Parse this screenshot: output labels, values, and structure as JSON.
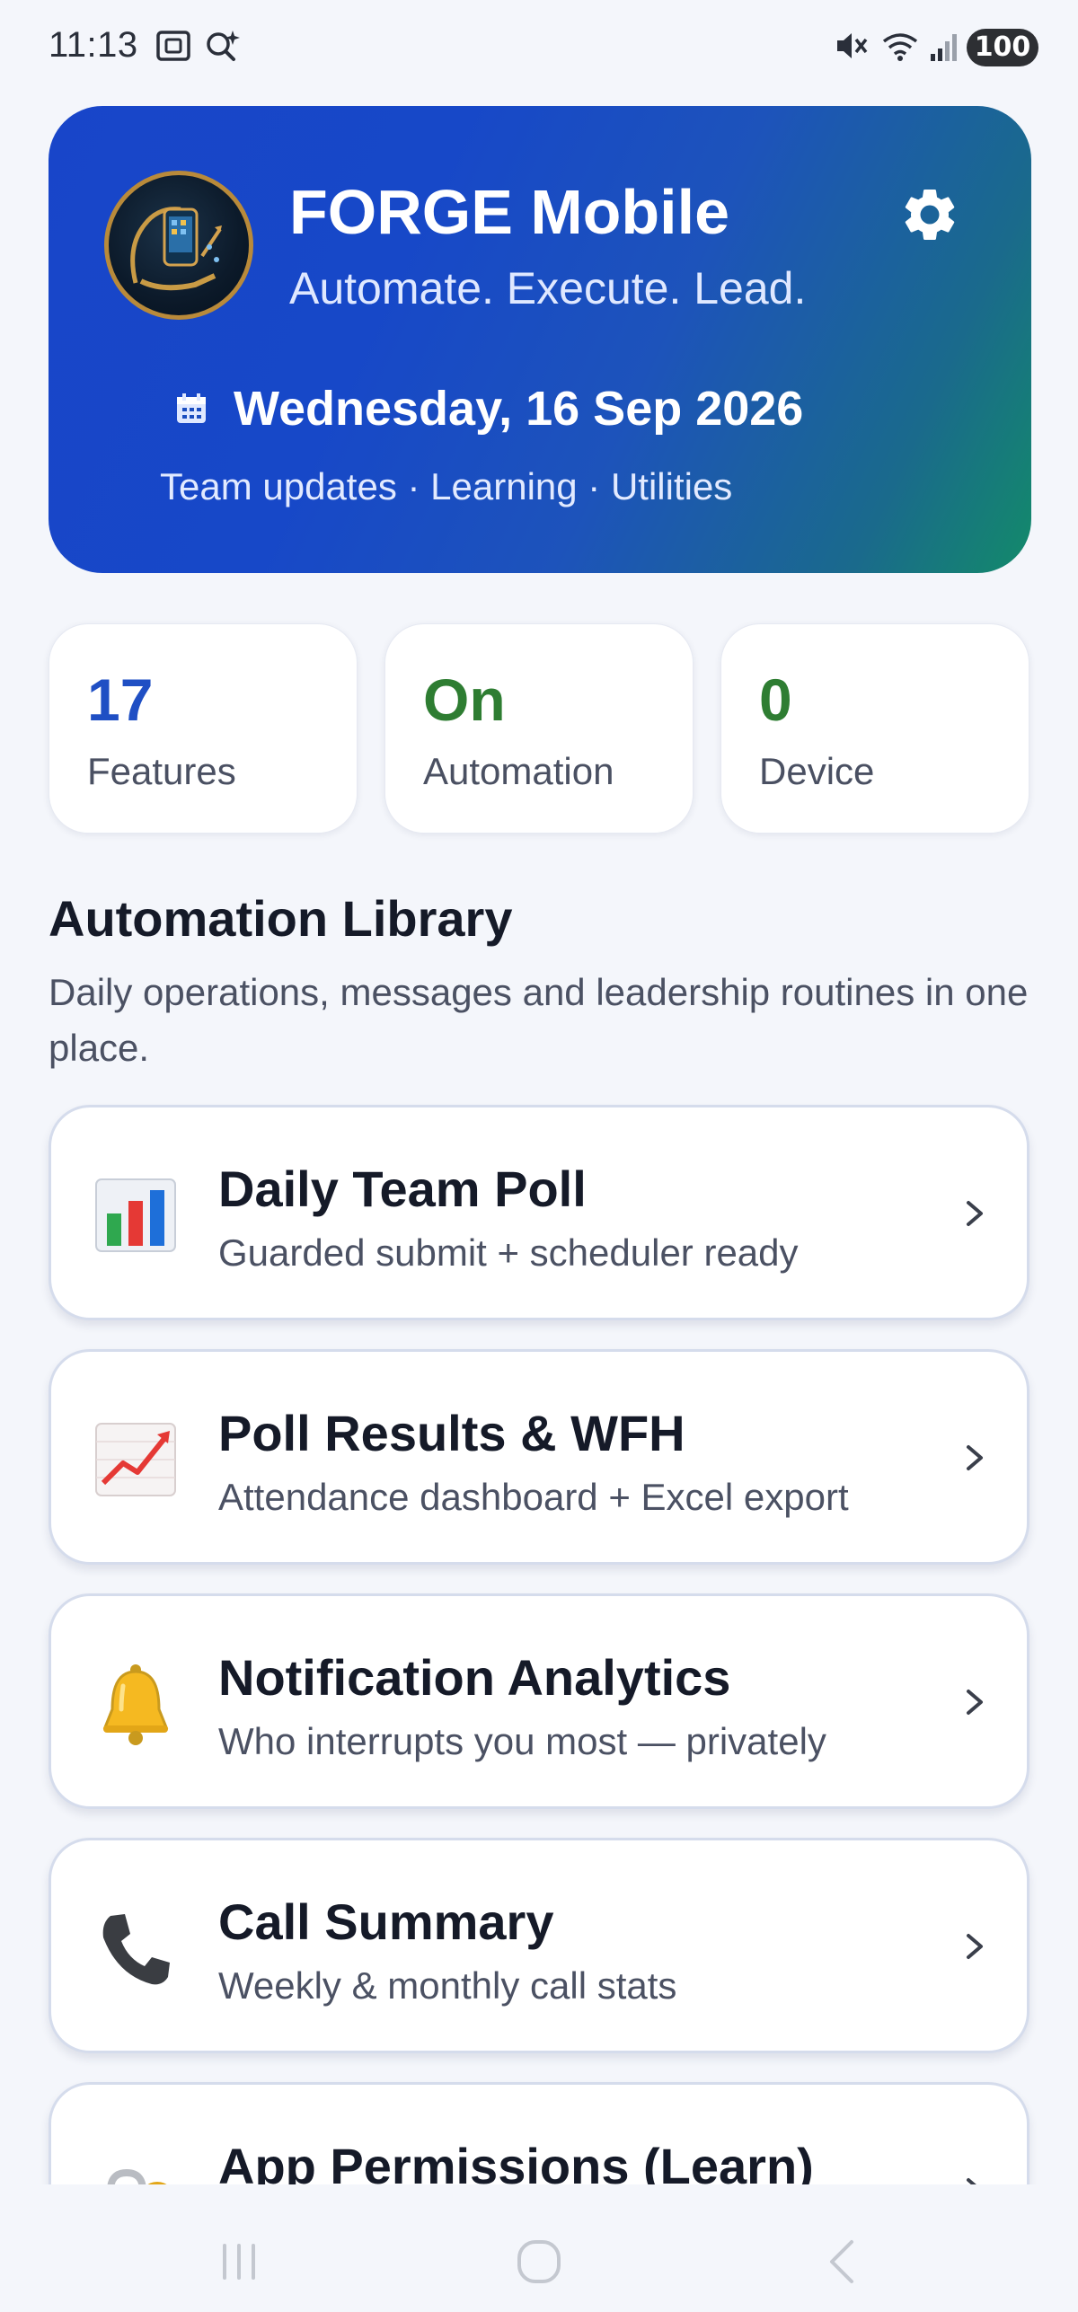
{
  "status_bar": {
    "time": "11:13",
    "battery": "100"
  },
  "hero": {
    "title": "FORGE Mobile",
    "tagline": "Automate. Execute. Lead.",
    "date": "Wednesday, 16 Sep 2026",
    "subtitle": "Team updates · Learning · Utilities",
    "gradient_start": "#1845c9",
    "gradient_end": "#138a6a"
  },
  "stats": [
    {
      "value": "17",
      "label": "Features",
      "color": "#1f4fc4"
    },
    {
      "value": "On",
      "label": "Automation",
      "color": "#2e7d32"
    },
    {
      "value": "0",
      "label": "Device",
      "color": "#2e7d32"
    }
  ],
  "library": {
    "title": "Automation Library",
    "description": "Daily operations, messages and leadership routines in one place.",
    "items": [
      {
        "icon": "bar-chart-icon",
        "title": "Daily Team Poll",
        "subtitle": "Guarded submit + scheduler ready"
      },
      {
        "icon": "trending-up-icon",
        "title": "Poll Results & WFH",
        "subtitle": "Attendance dashboard + Excel export"
      },
      {
        "icon": "bell-icon",
        "title": "Notification Analytics",
        "subtitle": "Who interrupts you most — privately"
      },
      {
        "icon": "phone-icon",
        "title": "Call Summary",
        "subtitle": "Weekly & monthly call stats"
      },
      {
        "icon": "lock-key-icon",
        "title": "App Permissions (Learn)",
        "subtitle": ""
      }
    ]
  }
}
